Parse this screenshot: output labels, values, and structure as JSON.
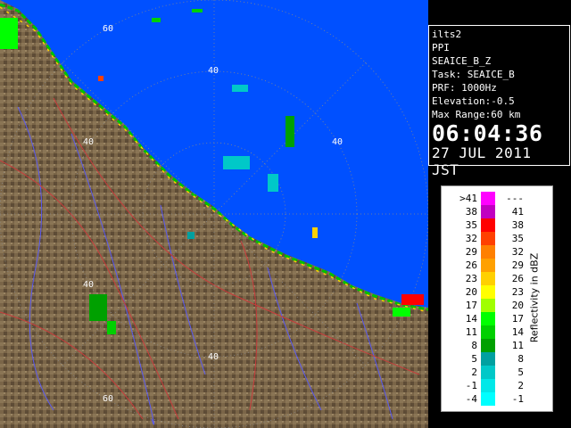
{
  "radar": {
    "range_labels": [
      "60",
      "40",
      "40",
      "40",
      "40",
      "40",
      "60"
    ]
  },
  "info": {
    "site": "ilts2",
    "mode": "PPI",
    "product": "SEAICE_B_Z",
    "task": "Task: SEAICE_B",
    "prf": "PRF: 1000Hz",
    "elevation": "Elevation:-0.5",
    "max_range": "Max Range:60 km",
    "time": "06:04:36",
    "date": "27 JUL 2011 JST"
  },
  "legend": {
    "title": "Reflectivity in dBZ",
    "rows": [
      {
        "lo": ">41",
        "hi": "---",
        "color": "#ff00ff"
      },
      {
        "lo": "38",
        "hi": "41",
        "color": "#c000c0"
      },
      {
        "lo": "35",
        "hi": "38",
        "color": "#ff0000"
      },
      {
        "lo": "32",
        "hi": "35",
        "color": "#ff4000"
      },
      {
        "lo": "29",
        "hi": "32",
        "color": "#ff8000"
      },
      {
        "lo": "26",
        "hi": "29",
        "color": "#ffa000"
      },
      {
        "lo": "23",
        "hi": "26",
        "color": "#ffd000"
      },
      {
        "lo": "20",
        "hi": "23",
        "color": "#ffff00"
      },
      {
        "lo": "17",
        "hi": "20",
        "color": "#a0ff00"
      },
      {
        "lo": "14",
        "hi": "17",
        "color": "#00ff00"
      },
      {
        "lo": "11",
        "hi": "14",
        "color": "#00d000"
      },
      {
        "lo": "8",
        "hi": "11",
        "color": "#00a000"
      },
      {
        "lo": "5",
        "hi": "8",
        "color": "#00a0a0"
      },
      {
        "lo": "2",
        "hi": "5",
        "color": "#00c8c8"
      },
      {
        "lo": "-1",
        "hi": "2",
        "color": "#00e8e8"
      },
      {
        "lo": "-4",
        "hi": "-1",
        "color": "#00ffff"
      }
    ]
  }
}
